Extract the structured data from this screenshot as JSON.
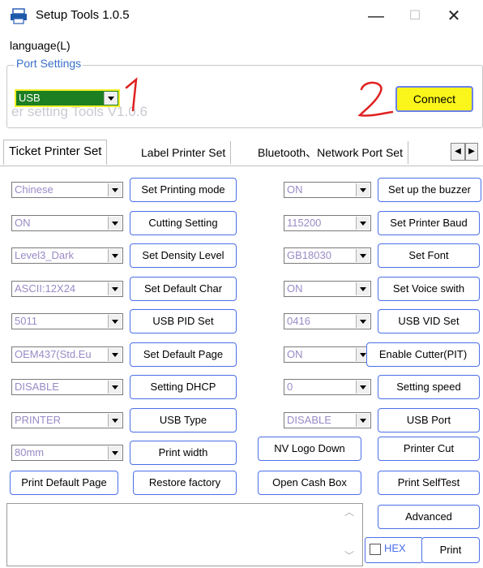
{
  "window": {
    "title": "Setup Tools 1.0.5",
    "minimize": "—",
    "maximize": "☐",
    "close": "✕"
  },
  "menu": {
    "language": "language(L)"
  },
  "port_settings": {
    "legend": "Port Settings",
    "ghost_text": "er setting Tools V1.0.6",
    "port_select": "USB",
    "connect_label": "Connect",
    "annotation_1": "1",
    "annotation_2": "2"
  },
  "tabs": [
    {
      "label": "Ticket Printer Set"
    },
    {
      "label": "Label Printer Set"
    },
    {
      "label": "Bluetooth、Network Port Set"
    }
  ],
  "left_rows": [
    {
      "value": "Chinese",
      "button": "Set Printing mode"
    },
    {
      "value": "ON",
      "button": "Cutting Setting"
    },
    {
      "value": "Level3_Dark",
      "button": "Set Density Level"
    },
    {
      "value": "ASCII:12X24",
      "button": "Set Default Char"
    },
    {
      "value": "5011",
      "button": "USB PID Set"
    },
    {
      "value": "OEM437(Std.Eu",
      "button": "Set Default Page"
    },
    {
      "value": "DISABLE",
      "button": "Setting DHCP"
    },
    {
      "value": "PRINTER",
      "button": "USB Type"
    },
    {
      "value": "80mm",
      "button": "Print width"
    }
  ],
  "right_rows": [
    {
      "value": "ON",
      "button": "Set  up the buzzer"
    },
    {
      "value": "115200",
      "button": "Set Printer Baud"
    },
    {
      "value": "GB18030",
      "button": "Set Font"
    },
    {
      "value": "ON",
      "button": "Set Voice swith"
    },
    {
      "value": "0416",
      "button": "USB VID Set"
    },
    {
      "value": "ON",
      "button": "Enable Cutter(PIT)"
    },
    {
      "value": "0",
      "button": "Setting speed"
    },
    {
      "value": "DISABLE",
      "button": "USB Port"
    }
  ],
  "action_buttons": {
    "nv_logo": "NV Logo Down",
    "printer_cut": "Printer Cut",
    "print_default_page": "Print Default Page",
    "restore_factory": "Restore factory",
    "open_cash_box": "Open Cash Box",
    "print_selftest": "Print SelfTest",
    "advanced": "Advanced",
    "print": "Print",
    "hex": "HEX"
  },
  "colors": {
    "button_border": "#4b6fe8",
    "combo_text": "#9a8ac6",
    "highlight_yellow": "#faf51a",
    "usb_green": "#1c7f22",
    "annotation_red": "#e02020"
  }
}
